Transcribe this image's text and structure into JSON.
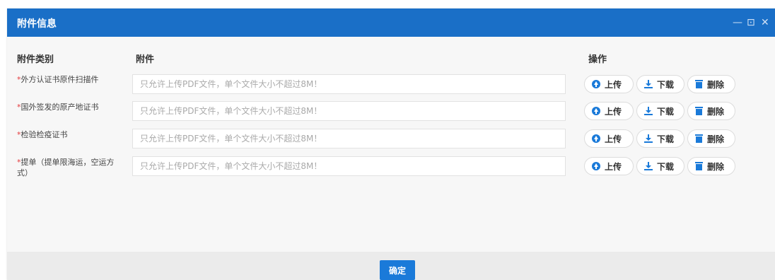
{
  "dialog": {
    "title": "附件信息",
    "controls": {
      "minimize": "—",
      "maximize": "⊡",
      "close": "✕"
    }
  },
  "columns": {
    "category": "附件类别",
    "attachment": "附件",
    "actions": "操作"
  },
  "rows": [
    {
      "required_mark": "*",
      "label": "外方认证书原件扫描件",
      "placeholder": "只允许上传PDF文件，单个文件大小不超过8M！"
    },
    {
      "required_mark": "*",
      "label": "国外签发的原产地证书",
      "placeholder": "只允许上传PDF文件，单个文件大小不超过8M！"
    },
    {
      "required_mark": "*",
      "label": "检验检疫证书",
      "placeholder": "只允许上传PDF文件，单个文件大小不超过8M！"
    },
    {
      "required_mark": "*",
      "label": "提单（提单限海运，空运方式）",
      "placeholder": "只允许上传PDF文件，单个文件大小不超过8M！"
    }
  ],
  "buttons": {
    "upload": "上传",
    "download": "下载",
    "delete": "删除",
    "confirm": "确定"
  },
  "colors": {
    "titlebar": "#1a6fc7",
    "accent": "#1a7ad9",
    "required": "#e4393c"
  }
}
